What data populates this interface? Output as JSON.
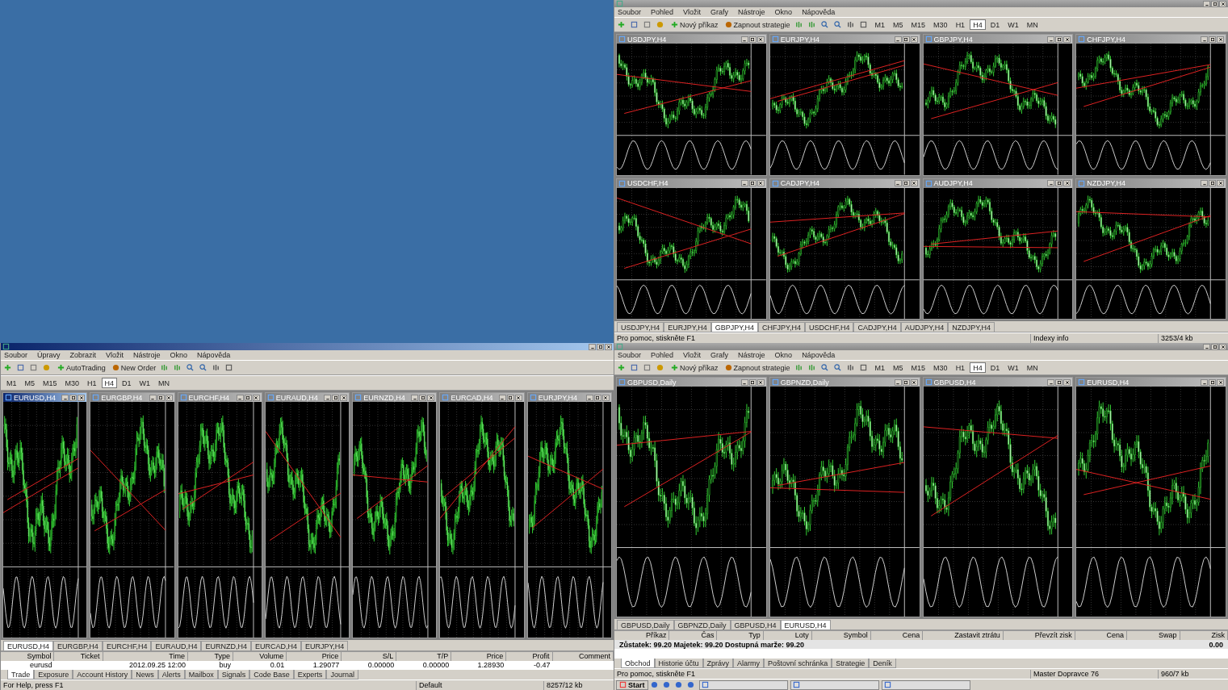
{
  "terminals": [
    {
      "kind": "grid",
      "active": false,
      "menu": [
        "Soubor",
        "Pohled",
        "Vložit",
        "Grafy",
        "Nástroje",
        "Okno",
        "Nápověda"
      ],
      "toolbar_buttons": [
        "Nový příkaz",
        "Zapnout strategie"
      ],
      "timeframes": [
        {
          "label": "M1",
          "selected": false
        },
        {
          "label": "M5",
          "selected": false
        },
        {
          "label": "M15",
          "selected": false
        },
        {
          "label": "M30",
          "selected": false
        },
        {
          "label": "H1",
          "selected": false
        },
        {
          "label": "H4",
          "selected": true
        },
        {
          "label": "D1",
          "selected": false
        },
        {
          "label": "W1",
          "selected": false
        },
        {
          "label": "MN",
          "selected": false
        }
      ],
      "charts": [
        {
          "title": "USDJPY,H4",
          "selected": false
        },
        {
          "title": "EURJPY,H4",
          "selected": false
        },
        {
          "title": "GBPJPY,H4",
          "selected": false
        },
        {
          "title": "CHFJPY,H4",
          "selected": false
        },
        {
          "title": "USDCHF,H4",
          "selected": false
        },
        {
          "title": "CADJPY,H4",
          "selected": false
        },
        {
          "title": "AUDJPY,H4",
          "selected": false
        },
        {
          "title": "NZDJPY,H4",
          "selected": false
        }
      ],
      "chart_tabs": [
        {
          "label": "USDJPY,H4",
          "selected": false
        },
        {
          "label": "EURJPY,H4",
          "selected": false
        },
        {
          "label": "GBPJPY,H4",
          "selected": true
        },
        {
          "label": "CHFJPY,H4",
          "selected": false
        },
        {
          "label": "USDCHF,H4",
          "selected": false
        },
        {
          "label": "CADJPY,H4",
          "selected": false
        },
        {
          "label": "AUDJPY,H4",
          "selected": false
        },
        {
          "label": "NZDJPY,H4",
          "selected": false
        }
      ],
      "status": [
        "Pro pomoc, stiskněte F1",
        "Indexy info",
        "3253/4 kb"
      ]
    },
    {
      "kind": "strip",
      "active": true,
      "menu": [
        "Soubor",
        "Úpravy",
        "Zobrazit",
        "Vložit",
        "Nástroje",
        "Okno",
        "Nápověda"
      ],
      "toolbar_buttons": [
        "AutoTrading",
        "New Order"
      ],
      "timeframes": [
        {
          "label": "M1",
          "selected": false
        },
        {
          "label": "M5",
          "selected": false
        },
        {
          "label": "M15",
          "selected": false
        },
        {
          "label": "M30",
          "selected": false
        },
        {
          "label": "H1",
          "selected": false
        },
        {
          "label": "H4",
          "selected": true
        },
        {
          "label": "D1",
          "selected": false
        },
        {
          "label": "W1",
          "selected": false
        },
        {
          "label": "MN",
          "selected": false
        }
      ],
      "charts": [
        {
          "title": "EURUSD,H4",
          "selected": true
        },
        {
          "title": "EURGBP,H4",
          "selected": false
        },
        {
          "title": "EURCHF,H4",
          "selected": false
        },
        {
          "title": "EURAUD,H4",
          "selected": false
        },
        {
          "title": "EURNZD,H4",
          "selected": false
        },
        {
          "title": "EURCAD,H4",
          "selected": false
        },
        {
          "title": "EURJPY,H4",
          "selected": false
        }
      ],
      "chart_tabs": [
        {
          "label": "EURUSD,H4",
          "selected": true
        },
        {
          "label": "EURGBP,H4",
          "selected": false
        },
        {
          "label": "EURCHF,H4",
          "selected": false
        },
        {
          "label": "EURAUD,H4",
          "selected": false
        },
        {
          "label": "EURNZD,H4",
          "selected": false
        },
        {
          "label": "EURCAD,H4",
          "selected": false
        },
        {
          "label": "EURJPY,H4",
          "selected": false
        }
      ],
      "terminal": {
        "columns": [
          "Symbol",
          "Ticket",
          "Time",
          "Type",
          "Volume",
          "Price",
          "S/L",
          "T/P",
          "Price",
          "Profit",
          "Comment"
        ],
        "rows": [
          [
            "eurusd",
            "",
            "2012.09.25 12:00",
            "buy",
            "0.01",
            "1.29077",
            "0.00000",
            "0.00000",
            "1.28930",
            "-0.47",
            ""
          ]
        ],
        "tabs": [
          {
            "label": "Trade",
            "selected": true
          },
          {
            "label": "Exposure",
            "selected": false
          },
          {
            "label": "Account History",
            "selected": false
          },
          {
            "label": "News",
            "selected": false
          },
          {
            "label": "Alerts",
            "selected": false
          },
          {
            "label": "Mailbox",
            "selected": false
          },
          {
            "label": "Signals",
            "selected": false
          },
          {
            "label": "Code Base",
            "selected": false
          },
          {
            "label": "Experts",
            "selected": false
          },
          {
            "label": "Journal",
            "selected": false
          }
        ]
      },
      "status": [
        "For Help, press F1",
        "Default",
        "8257/12 kb"
      ]
    },
    {
      "kind": "grid-wide",
      "active": false,
      "menu": [
        "Soubor",
        "Pohled",
        "Vložit",
        "Grafy",
        "Nástroje",
        "Okno",
        "Nápověda"
      ],
      "toolbar_buttons": [
        "Nový příkaz",
        "Zapnout strategie"
      ],
      "timeframes": [
        {
          "label": "M1",
          "selected": false
        },
        {
          "label": "M5",
          "selected": false
        },
        {
          "label": "M15",
          "selected": false
        },
        {
          "label": "M30",
          "selected": false
        },
        {
          "label": "H1",
          "selected": false
        },
        {
          "label": "H4",
          "selected": true
        },
        {
          "label": "D1",
          "selected": false
        },
        {
          "label": "W1",
          "selected": false
        },
        {
          "label": "MN",
          "selected": false
        }
      ],
      "charts": [
        {
          "title": "GBPUSD,Daily",
          "selected": false
        },
        {
          "title": "GBPNZD,Daily",
          "selected": false
        },
        {
          "title": "GBPUSD,H4",
          "selected": false
        },
        {
          "title": "EURUSD,H4",
          "selected": false
        }
      ],
      "chart_tabs": [
        {
          "label": "GBPUSD,Daily",
          "selected": false
        },
        {
          "label": "GBPNZD,Daily",
          "selected": false
        },
        {
          "label": "GBPUSD,H4",
          "selected": false
        },
        {
          "label": "EURUSD,H4",
          "selected": true
        }
      ],
      "terminal": {
        "columns": [
          "Příkaz",
          "Čas",
          "Typ",
          "Loty",
          "Symbol",
          "Cena",
          "Zastavit ztrátu",
          "Převzít zisk",
          "Cena",
          "Swap",
          "Zisk"
        ],
        "summary": "Zůstatek: 99.20  Majetek: 99.20  Dostupná marže: 99.20",
        "summary_value": "0.00",
        "tabs": [
          {
            "label": "Obchod",
            "selected": true
          },
          {
            "label": "Historie účtu",
            "selected": false
          },
          {
            "label": "Zprávy",
            "selected": false
          },
          {
            "label": "Alarmy",
            "selected": false
          },
          {
            "label": "Poštovní schránka",
            "selected": false
          },
          {
            "label": "Strategie",
            "selected": false
          },
          {
            "label": "Deník",
            "selected": false
          }
        ]
      },
      "status": [
        "Pro pomoc, stiskněte F1",
        "Master Dopravce 76",
        "960/7 kb"
      ],
      "taskbar": {
        "start": "Start"
      }
    }
  ]
}
